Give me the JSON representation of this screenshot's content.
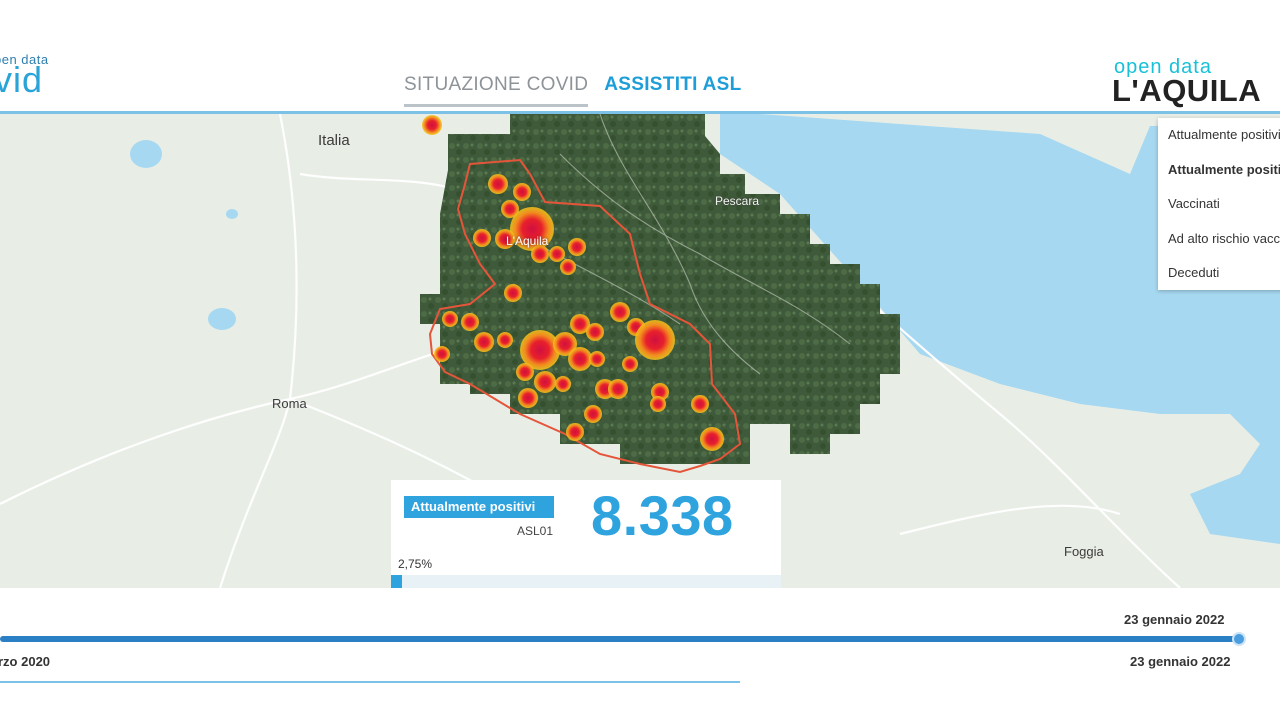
{
  "header": {
    "logo_left_small": "pen data",
    "logo_left_big": "vid",
    "logo_right_small": "open data",
    "logo_right_big": "L'AQUILA",
    "tabs": [
      {
        "label": "SITUAZIONE COVID",
        "active": false
      },
      {
        "label": "ASSISTITI ASL",
        "active": true
      }
    ]
  },
  "map": {
    "places": [
      "Italia",
      "Pescara",
      "L'Aquila",
      "Roma",
      "Foggia"
    ],
    "colors": {
      "sea": "#a6d8f1",
      "land": "#e8eee6",
      "region_outline": "#e5553a",
      "hotspot_core": "#d01040",
      "hotspot_halo": "#f7c51b"
    }
  },
  "layer_menu": {
    "items": [
      {
        "label": "Attualmente positivi",
        "selected": false
      },
      {
        "label": "Attualmente positivi",
        "selected": true
      },
      {
        "label": "Vaccinati",
        "selected": false
      },
      {
        "label": "Ad alto rischio vaccinale",
        "selected": false
      },
      {
        "label": "Deceduti",
        "selected": false
      }
    ]
  },
  "info": {
    "label": "Attualmente positivi",
    "asl": "ASL01",
    "value": "8.338",
    "percent_text": "2,75%",
    "percent": 2.75
  },
  "timeline": {
    "current_date": "23 gennaio 2022",
    "start_date": "rzo 2020",
    "end_date": "23 gennaio 2022",
    "position": 1.0
  }
}
